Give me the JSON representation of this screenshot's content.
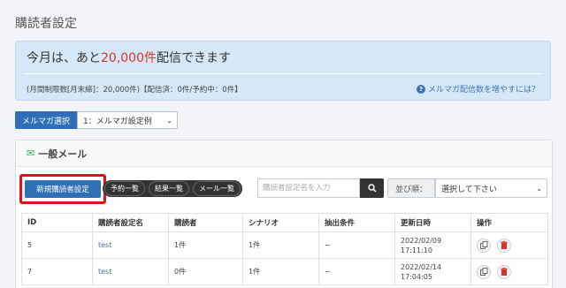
{
  "page": {
    "title": "購読者設定"
  },
  "notice": {
    "head_prefix": "今月は、あと",
    "head_highlight": "20,000件",
    "head_suffix": "配信できます",
    "sub_text": "(月間制限数[月末締]：20,000件)【配信済：0件/予約中：0件】",
    "help_link": "メルマガ配信数を増やすには？"
  },
  "magazine_select": {
    "label": "メルマガ選択",
    "value": "1：メルマガ設定例"
  },
  "panel": {
    "title": "一般メール",
    "new_button": "新規購読者設定",
    "pills": [
      "予約一覧",
      "結果一覧",
      "メール一覧"
    ],
    "search_placeholder": "購読者設定名を入力",
    "sort_label": "並び順：",
    "sort_value": "選択して下さい"
  },
  "table": {
    "headers": [
      "ID",
      "購読者設定名",
      "購読者",
      "シナリオ",
      "抽出条件",
      "更新日時",
      "操作"
    ],
    "rows": [
      {
        "id": "5",
        "name": "test",
        "subscribers": "1件",
        "scenario": "1件",
        "condition": "−",
        "date": "2022/02/09",
        "time": "17:11:10"
      },
      {
        "id": "7",
        "name": "test",
        "subscribers": "0件",
        "scenario": "1件",
        "condition": "−",
        "date": "2022/02/14",
        "time": "17:04:05"
      }
    ]
  },
  "colors": {
    "primary": "#2e6fb7",
    "highlight": "#e0322d",
    "notice_bg": "#d5e8f7",
    "focus_border": "#e20f1c"
  }
}
